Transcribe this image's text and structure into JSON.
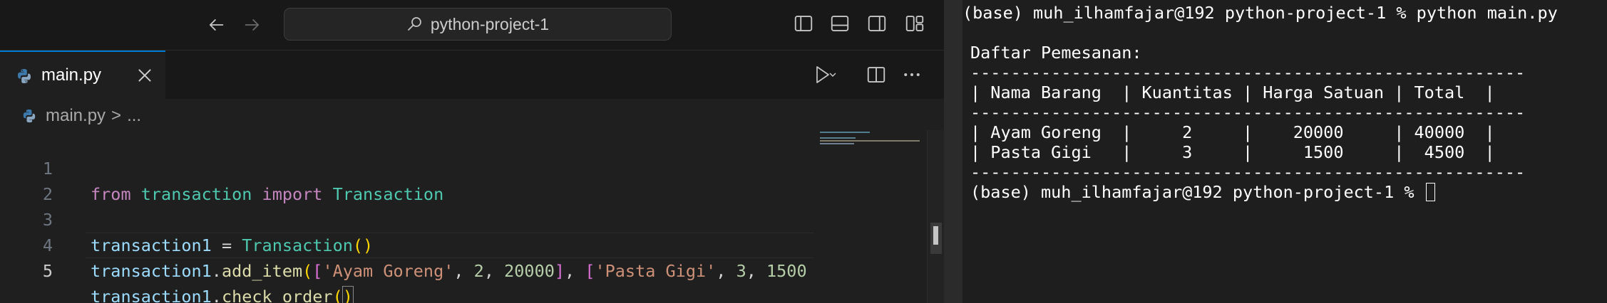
{
  "titlebar": {
    "project_name": "python-project-1",
    "back_icon": "arrow-left-icon",
    "forward_icon": "arrow-right-icon",
    "search_icon": "search-icon"
  },
  "tab": {
    "filename": "main.py",
    "icon": "python-icon",
    "close_icon": "close-icon"
  },
  "breadcrumb": {
    "file": "main.py",
    "separator": ">",
    "more": "..."
  },
  "code_lines": [
    {
      "number": "1",
      "text": "from transaction import Transaction"
    },
    {
      "number": "2",
      "text": ""
    },
    {
      "number": "3",
      "text": "transaction1 = Transaction()"
    },
    {
      "number": "4",
      "text": "transaction1.add_item(['Ayam Goreng', 2, 20000], ['Pasta Gigi', 3, 1500"
    },
    {
      "number": "5",
      "text": "transaction1.check_order()"
    }
  ],
  "code_tokens": {
    "from": "from",
    "module": "transaction",
    "import": "import",
    "cls": "Transaction",
    "var": "transaction1",
    "eq": "=",
    "dot": ".",
    "method_add": "add_item",
    "method_check": "check_order",
    "str_ayam": "'Ayam Goreng'",
    "num_2": "2",
    "num_20000": "20000",
    "str_pasta": "'Pasta Gigi'",
    "num_3": "3",
    "num_1500": "1500"
  },
  "terminal": {
    "lines": [
      "(base) muh_ilhamfajar@192 python-project-1 % python main.py",
      "",
      "Daftar Pemesanan:",
      "-------------------------------------------------------",
      "| Nama Barang  | Kuantitas | Harga Satuan | Total  |",
      "-------------------------------------------------------",
      "| Ayam Goreng  |     2     |    20000     | 40000  |",
      "| Pasta Gigi   |     3     |     1500     |  4500  |",
      "-------------------------------------------------------",
      "(base) muh_ilhamfajar@192 python-project-1 % "
    ]
  },
  "colors": {
    "accent": "#0078d4",
    "editor_bg": "#1f1f1f",
    "terminal_bg": "#1e1e1e"
  }
}
